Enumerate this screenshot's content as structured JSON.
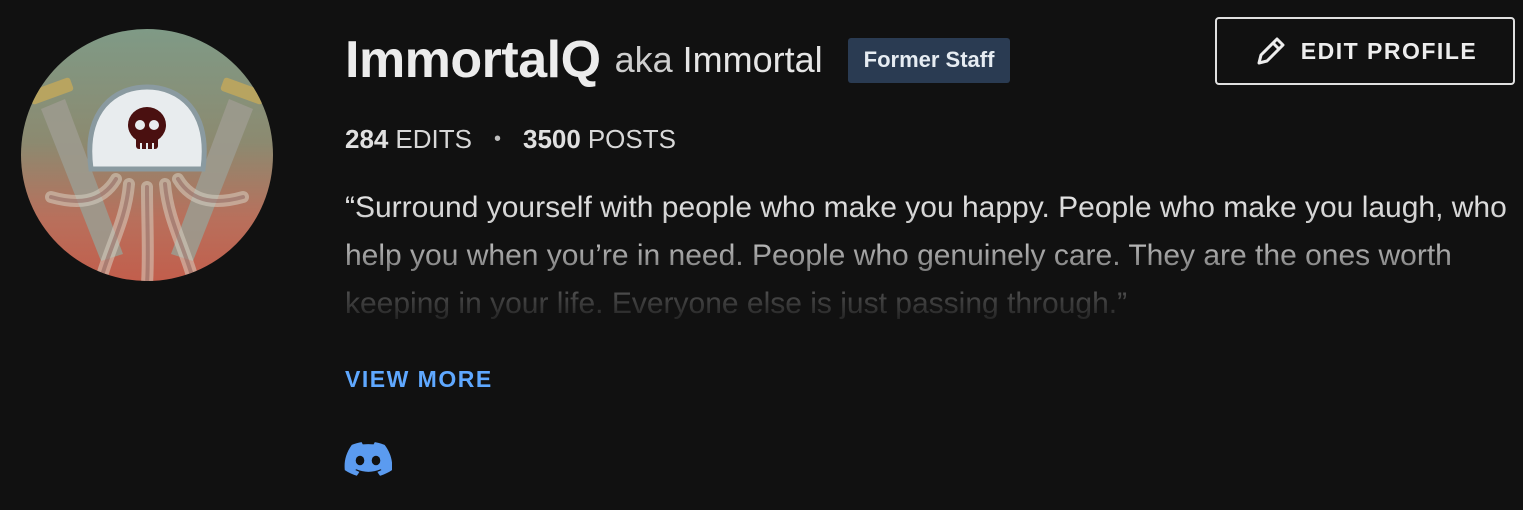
{
  "profile": {
    "username": "ImmortalQ",
    "aka_word": "aka",
    "aka_name": "Immortal",
    "badge": "Former Staff",
    "edit_button": "EDIT PROFILE",
    "stats": {
      "edits_count": "284",
      "edits_label": "EDITS",
      "separator": "•",
      "posts_count": "3500",
      "posts_label": "POSTS"
    },
    "bio": "“Surround yourself with people who make you happy. People who make you laugh, who help you when you’re in need. People who genuinely care. They are the ones worth keeping in your life. Everyone else is just passing through.”",
    "view_more": "VIEW MORE",
    "social": {
      "discord_icon": "discord-icon"
    },
    "avatar_icon": "jellyfish-skull-avatar"
  },
  "colors": {
    "background": "#111111",
    "badge_bg": "#2a3b52",
    "link": "#5fa8ff",
    "discord": "#5b9bf0"
  }
}
